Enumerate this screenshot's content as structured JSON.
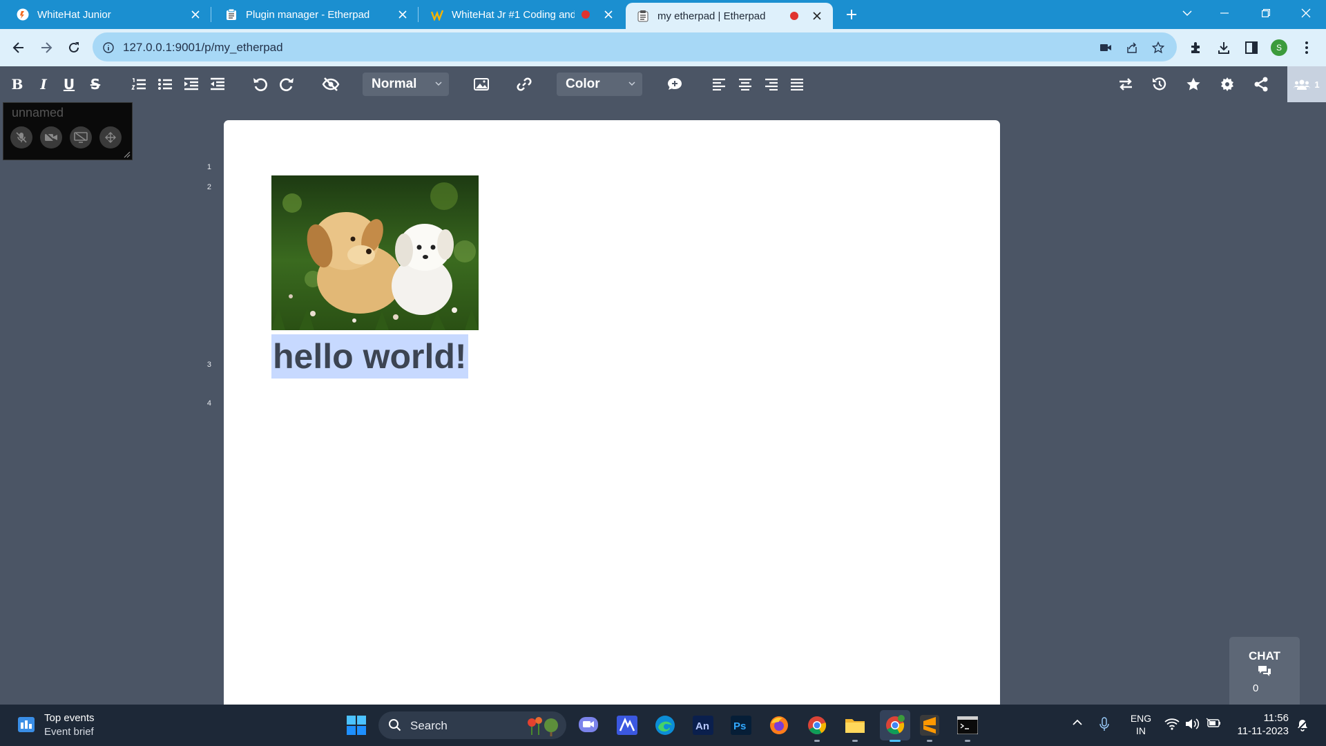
{
  "browser": {
    "tabs": [
      {
        "title": "WhiteHat Junior",
        "favicon": "whitehat-icon",
        "active": false,
        "recording": false
      },
      {
        "title": "Plugin manager - Etherpad",
        "favicon": "etherpad-icon",
        "active": false,
        "recording": false
      },
      {
        "title": "WhiteHat Jr #1 Coding and",
        "favicon": "whitehat-jr-icon",
        "active": false,
        "recording": true
      },
      {
        "title": "my etherpad | Etherpad",
        "favicon": "etherpad-icon",
        "active": true,
        "recording": true
      }
    ],
    "url": "127.0.0.1:9001/p/my_etherpad",
    "profile_initial": "S",
    "accent": "#1b8fd0"
  },
  "toolbar": {
    "style_select": "Normal",
    "color_select": "Color",
    "users_count": "1"
  },
  "video": {
    "name_placeholder": "unnamed"
  },
  "editor": {
    "line_numbers": [
      "1",
      "2",
      "3",
      "4"
    ],
    "image_alt": "puppies-image",
    "text": "hello world!"
  },
  "chat": {
    "label": "CHAT",
    "count": "0"
  },
  "taskbar": {
    "widget_title": "Top events",
    "widget_subtitle": "Event brief",
    "search_placeholder": "Search",
    "lang_top": "ENG",
    "lang_bottom": "IN",
    "time": "11:56",
    "date": "11-11-2023"
  }
}
